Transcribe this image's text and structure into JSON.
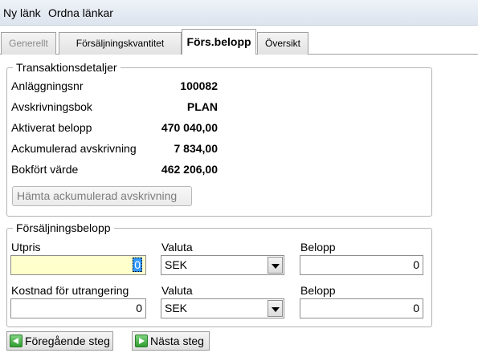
{
  "menu": {
    "new_link": "Ny länk",
    "arrange_links": "Ordna länkar"
  },
  "tabs": [
    {
      "label": "Generellt"
    },
    {
      "label": "Försäljningskvantitet"
    },
    {
      "label": "Förs.belopp"
    },
    {
      "label": "Översikt"
    }
  ],
  "transaction": {
    "title": "Transaktionsdetaljer",
    "rows": [
      {
        "label": "Anläggningsnr",
        "value": "100082"
      },
      {
        "label": "Avskrivningsbok",
        "value": "PLAN"
      },
      {
        "label": "Aktiverat belopp",
        "value": "470 040,00"
      },
      {
        "label": "Ackumulerad avskrivning",
        "value": "7 834,00"
      },
      {
        "label": "Bokfört värde",
        "value": "462 206,00"
      }
    ],
    "fetch_button": "Hämta ackumulerad avskrivning"
  },
  "sales": {
    "title": "Försäljningsbelopp",
    "row1": {
      "price_label": "Utpris",
      "price_value": "0",
      "currency_label": "Valuta",
      "currency_value": "SEK",
      "amount_label": "Belopp",
      "amount_value": "0"
    },
    "row2": {
      "cost_label": "Kostnad för utrangering",
      "cost_value": "0",
      "currency_label": "Valuta",
      "currency_value": "SEK",
      "amount_label": "Belopp",
      "amount_value": "0"
    }
  },
  "nav": {
    "prev": "Föregående steg",
    "next": "Nästa steg"
  }
}
